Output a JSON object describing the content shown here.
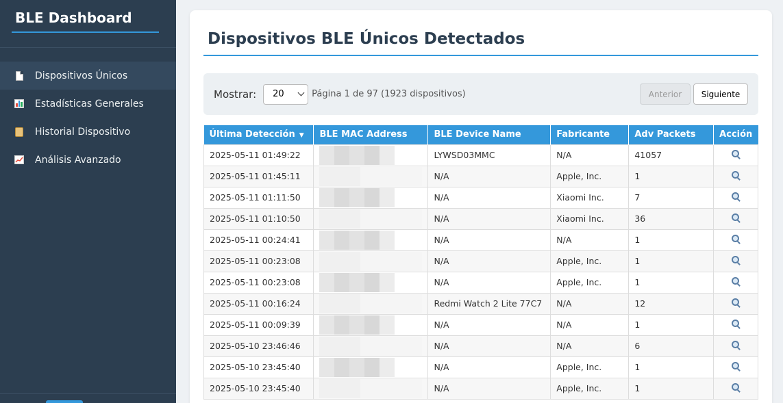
{
  "sidebar": {
    "brand": "BLE Dashboard",
    "items": [
      {
        "label": "Dispositivos Únicos",
        "icon": "document-icon",
        "active": true
      },
      {
        "label": "Estadísticas Generales",
        "icon": "bar-chart-icon",
        "active": false
      },
      {
        "label": "Historial Dispositivo",
        "icon": "scroll-icon",
        "active": false
      },
      {
        "label": "Análisis Avanzado",
        "icon": "trend-chart-icon",
        "active": false
      }
    ]
  },
  "main": {
    "title": "Dispositivos BLE Únicos Detectados",
    "controls": {
      "show_label": "Mostrar:",
      "page_size": "20",
      "page_info": "Página 1 de 97 (1923 dispositivos)",
      "prev_label": "Anterior",
      "next_label": "Siguiente"
    },
    "table": {
      "columns": [
        "Última Detección",
        "BLE MAC Address",
        "BLE Device Name",
        "Fabricante",
        "Adv Packets",
        "Acción"
      ],
      "sort_indicator": "▼",
      "rows": [
        {
          "last_seen": "2025-05-11 01:49:22",
          "name": "LYWSD03MMC",
          "manufacturer": "N/A",
          "packets": "41057"
        },
        {
          "last_seen": "2025-05-11 01:45:11",
          "name": "N/A",
          "manufacturer": "Apple, Inc.",
          "packets": "1"
        },
        {
          "last_seen": "2025-05-11 01:11:50",
          "name": "N/A",
          "manufacturer": "Xiaomi Inc.",
          "packets": "7"
        },
        {
          "last_seen": "2025-05-11 01:10:50",
          "name": "N/A",
          "manufacturer": "Xiaomi Inc.",
          "packets": "36"
        },
        {
          "last_seen": "2025-05-11 00:24:41",
          "name": "N/A",
          "manufacturer": "N/A",
          "packets": "1"
        },
        {
          "last_seen": "2025-05-11 00:23:08",
          "name": "N/A",
          "manufacturer": "Apple, Inc.",
          "packets": "1"
        },
        {
          "last_seen": "2025-05-11 00:23:08",
          "name": "N/A",
          "manufacturer": "Apple, Inc.",
          "packets": "1"
        },
        {
          "last_seen": "2025-05-11 00:16:24",
          "name": "Redmi Watch 2 Lite 77C7",
          "manufacturer": "N/A",
          "packets": "12"
        },
        {
          "last_seen": "2025-05-11 00:09:39",
          "name": "N/A",
          "manufacturer": "N/A",
          "packets": "1"
        },
        {
          "last_seen": "2025-05-10 23:46:46",
          "name": "N/A",
          "manufacturer": "N/A",
          "packets": "6"
        },
        {
          "last_seen": "2025-05-10 23:45:40",
          "name": "N/A",
          "manufacturer": "Apple, Inc.",
          "packets": "1"
        },
        {
          "last_seen": "2025-05-10 23:45:40",
          "name": "N/A",
          "manufacturer": "Apple, Inc.",
          "packets": "1"
        }
      ]
    }
  },
  "colors": {
    "sidebar_bg": "#2c3e50",
    "accent": "#3498db"
  }
}
